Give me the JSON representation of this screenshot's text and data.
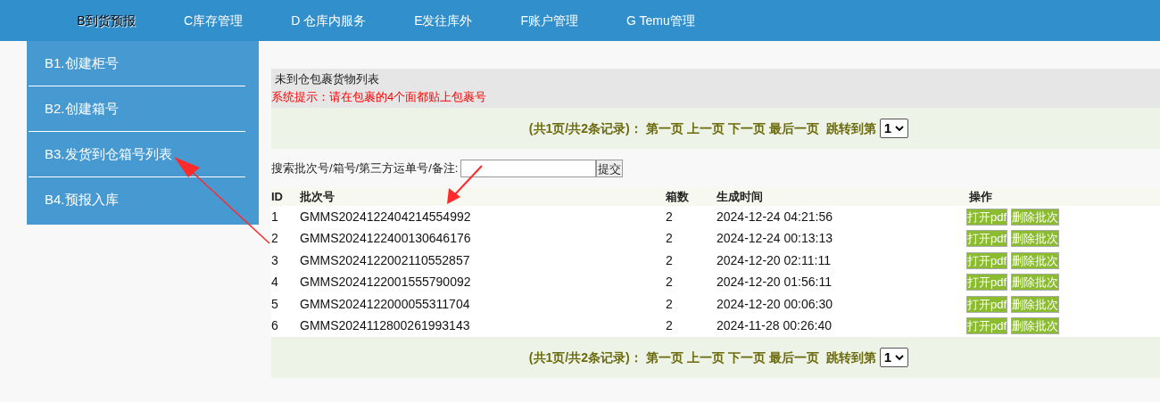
{
  "nav": [
    {
      "label": "B到货预报",
      "selected": true
    },
    {
      "label": "C库存管理",
      "selected": false
    },
    {
      "label": "D 仓库内服务",
      "selected": false
    },
    {
      "label": "E发往库外",
      "selected": false
    },
    {
      "label": "F账户管理",
      "selected": false
    },
    {
      "label": "G Temu管理",
      "selected": false
    }
  ],
  "submenu": [
    "B1.创建柜号",
    "B2.创建箱号",
    "B3.发货到仓箱号列表",
    "B4.预报入库"
  ],
  "panel": {
    "title": "未到仓包裹货物列表",
    "notice": "系统提示：请在包裹的4个面都贴上包裹号"
  },
  "pager_top": {
    "summary": "(共1页/共2条记录)：",
    "links": [
      "第一页",
      "上一页",
      "下一页",
      "最后一页"
    ],
    "jump_label": "跳转到第",
    "page": "1"
  },
  "search": {
    "label": "搜索批次号/箱号/第三方运单号/备注:",
    "button": "提交"
  },
  "table": {
    "columns": [
      "ID",
      "批次号",
      "箱数",
      "生成时间",
      "操作"
    ],
    "rows": [
      {
        "id": "1",
        "batch": "GMMS2024122404214554992",
        "boxes": "2",
        "time": "2024-12-24 04:21:56",
        "actions": [
          "打开pdf",
          "删除批次"
        ]
      },
      {
        "id": "2",
        "batch": "GMMS2024122400130646176",
        "boxes": "2",
        "time": "2024-12-24 00:13:13",
        "actions": [
          "打开pdf",
          "删除批次"
        ]
      },
      {
        "id": "3",
        "batch": "GMMS2024122002110552857",
        "boxes": "2",
        "time": "2024-12-20 02:11:11",
        "actions": [
          "打开pdf",
          "删除批次"
        ]
      },
      {
        "id": "4",
        "batch": "GMMS2024122001555790092",
        "boxes": "2",
        "time": "2024-12-20 01:56:11",
        "actions": [
          "打开pdf",
          "删除批次"
        ]
      },
      {
        "id": "5",
        "batch": "GMMS2024122000055311704",
        "boxes": "2",
        "time": "2024-12-20 00:06:30",
        "actions": [
          "打开pdf",
          "删除批次"
        ]
      },
      {
        "id": "6",
        "batch": "GMMS2024112800261993143",
        "boxes": "2",
        "time": "2024-11-28 00:26:40",
        "actions": [
          "打开pdf",
          "删除批次"
        ]
      }
    ]
  },
  "pager_bottom": {
    "summary": "(共1页/共2条记录)：",
    "links": [
      "第一页",
      "上一页",
      "下一页",
      "最后一页"
    ],
    "jump_label": "跳转到第",
    "page": "1"
  }
}
